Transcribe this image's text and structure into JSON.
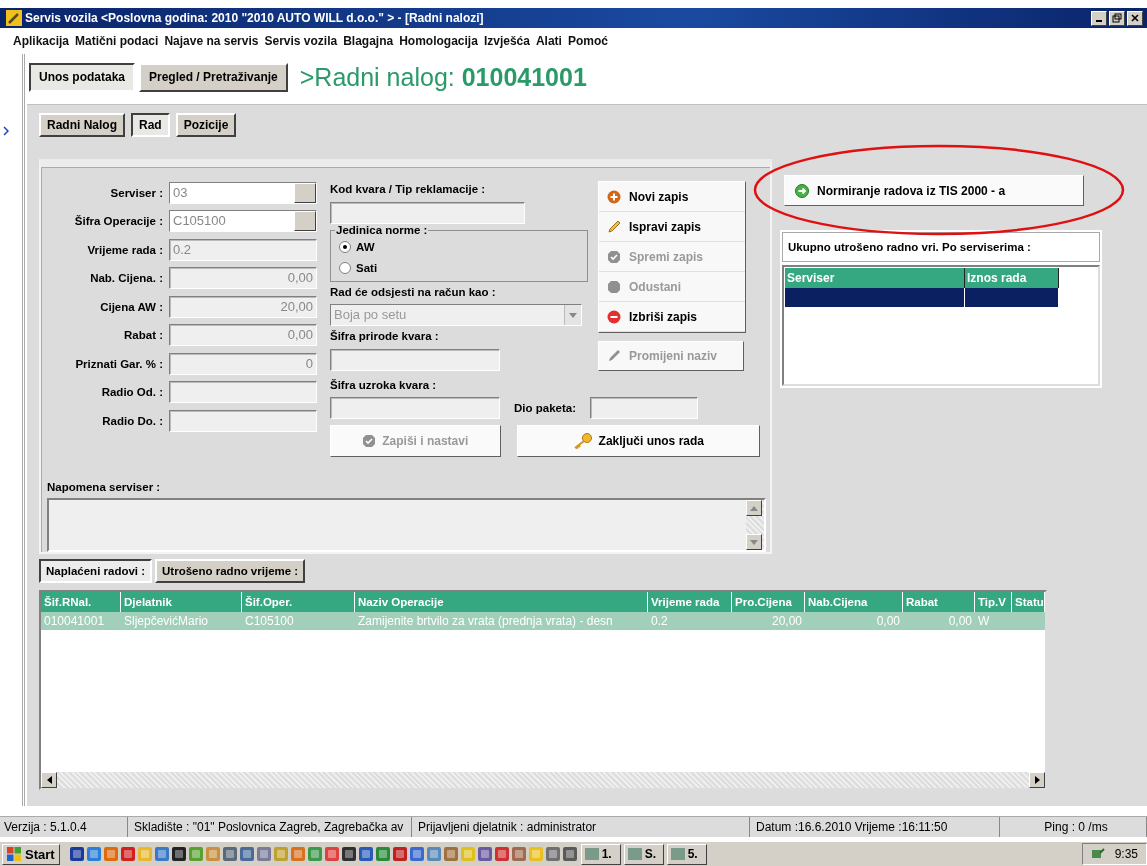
{
  "window": {
    "title": "Servis vozila <Poslovna godina: 2010 \"2010 AUTO WILL d.o.o.\" > - [Radni nalozi]"
  },
  "menu": [
    "Aplikacija",
    "Matični podaci",
    "Najave na servis",
    "Servis vozila",
    "Blagajna",
    "Homologacija",
    "Izvješća",
    "Alati",
    "Pomoć"
  ],
  "view_tabs": [
    {
      "label": "Unos podataka",
      "selected": true
    },
    {
      "label": "Pregled / Pretraživanje",
      "selected": false
    }
  ],
  "heading": {
    "prefix": ">Radni nalog: ",
    "number": "010041001"
  },
  "sub_tabs": [
    {
      "label": "Radni Nalog",
      "selected": false
    },
    {
      "label": "Rad",
      "selected": true
    },
    {
      "label": "Pozicije",
      "selected": false
    }
  ],
  "form_fields": [
    {
      "label": "Serviser :",
      "value": "03",
      "kind": "lookup"
    },
    {
      "label": "Šifra Operacije :",
      "value": "C105100",
      "kind": "lookup"
    },
    {
      "label": "Vrijeme rada :",
      "value": "0.2",
      "kind": "text"
    },
    {
      "label": "Nab. Cijena. :",
      "value": "0,00",
      "kind": "number"
    },
    {
      "label": "Cijena AW :",
      "value": "20,00",
      "kind": "number"
    },
    {
      "label": "Rabat :",
      "value": "0,00",
      "kind": "number"
    },
    {
      "label": "Priznati Gar. % :",
      "value": "0",
      "kind": "number"
    },
    {
      "label": "Radio Od. :",
      "kind": "text"
    },
    {
      "label": "Radio Do. :",
      "kind": "text"
    }
  ],
  "kod_kvara": {
    "label": "Kod kvara / Tip reklamacije :"
  },
  "jedinica_norme": {
    "legend": "Jedinica norme :",
    "options": [
      {
        "label": "AW",
        "selected": true
      },
      {
        "label": "Sati",
        "selected": false
      }
    ]
  },
  "rad_racun": {
    "label": "Rad će odsjesti na račun kao :",
    "value": "Boja po setu"
  },
  "sifra_prirode": {
    "label": "Šifra prirode kvara :"
  },
  "sifra_uzroka": {
    "label": "Šifra uzroka kvara :"
  },
  "dio_paketa": {
    "label": "Dio paketa:"
  },
  "record_buttons": [
    {
      "label": "Novi zapis",
      "kind": "new",
      "disabled": false
    },
    {
      "label": "Ispravi zapis",
      "kind": "edit",
      "disabled": false
    },
    {
      "label": "Spremi zapis",
      "kind": "save",
      "disabled": true
    },
    {
      "label": "Odustani",
      "kind": "cancel",
      "disabled": true
    },
    {
      "label": "Izbriši zapis",
      "kind": "delete",
      "disabled": false
    }
  ],
  "rename_button": {
    "label": "Promijeni naziv",
    "disabled": true
  },
  "action_buttons": [
    {
      "label": "Zapiši i nastavi",
      "kind": "save",
      "disabled": true
    },
    {
      "label": "Zaključi unos rada",
      "kind": "key",
      "disabled": false
    }
  ],
  "napomena": {
    "label": "Napomena serviser :"
  },
  "norm_button": {
    "label": "Normiranje radova iz TIS 2000 - a",
    "highlighted": true
  },
  "summary": {
    "title": "Ukupno utrošeno radno vri. Po serviserima :",
    "columns": [
      "Serviser",
      "Iznos rada"
    ],
    "rows": [
      {
        "cells": [
          "",
          ""
        ],
        "selected": true
      }
    ]
  },
  "bottom_tabs": [
    {
      "label": "Naplaćeni radovi :",
      "selected": true
    },
    {
      "label": "Utrošeno radno vrijeme :",
      "selected": false
    }
  ],
  "table": {
    "columns": [
      "Šif.RNal.",
      "Djelatnik",
      "Šif.Oper.",
      "Naziv Operacije",
      "Vrijeme rada",
      "Pro.Cijena",
      "Nab.Cijena",
      "Rabat",
      "Tip.V",
      "Statu"
    ],
    "rows": [
      {
        "cells": [
          "010041001",
          "SljepčevićMario",
          "C105100",
          "Zamijenite brtvilo za vrata (prednja vrata) - desn",
          "0.2",
          "20,00",
          "0,00",
          "0,00",
          "W"
        ],
        "selected": true
      }
    ]
  },
  "status_bar": [
    "Verzija : 5.1.0.4",
    "Skladište :  \"01\" Poslovnica Zagreb, Zagrebačka av",
    "Prijavljeni djelatnik :  administrator",
    "Datum :16.6.2010 Vrijeme :16:11:50",
    "Ping : 0 /ms"
  ],
  "taskbar": {
    "start": "Start",
    "tasks": [
      "1.",
      "S.",
      "5."
    ],
    "clock": "9:35"
  }
}
